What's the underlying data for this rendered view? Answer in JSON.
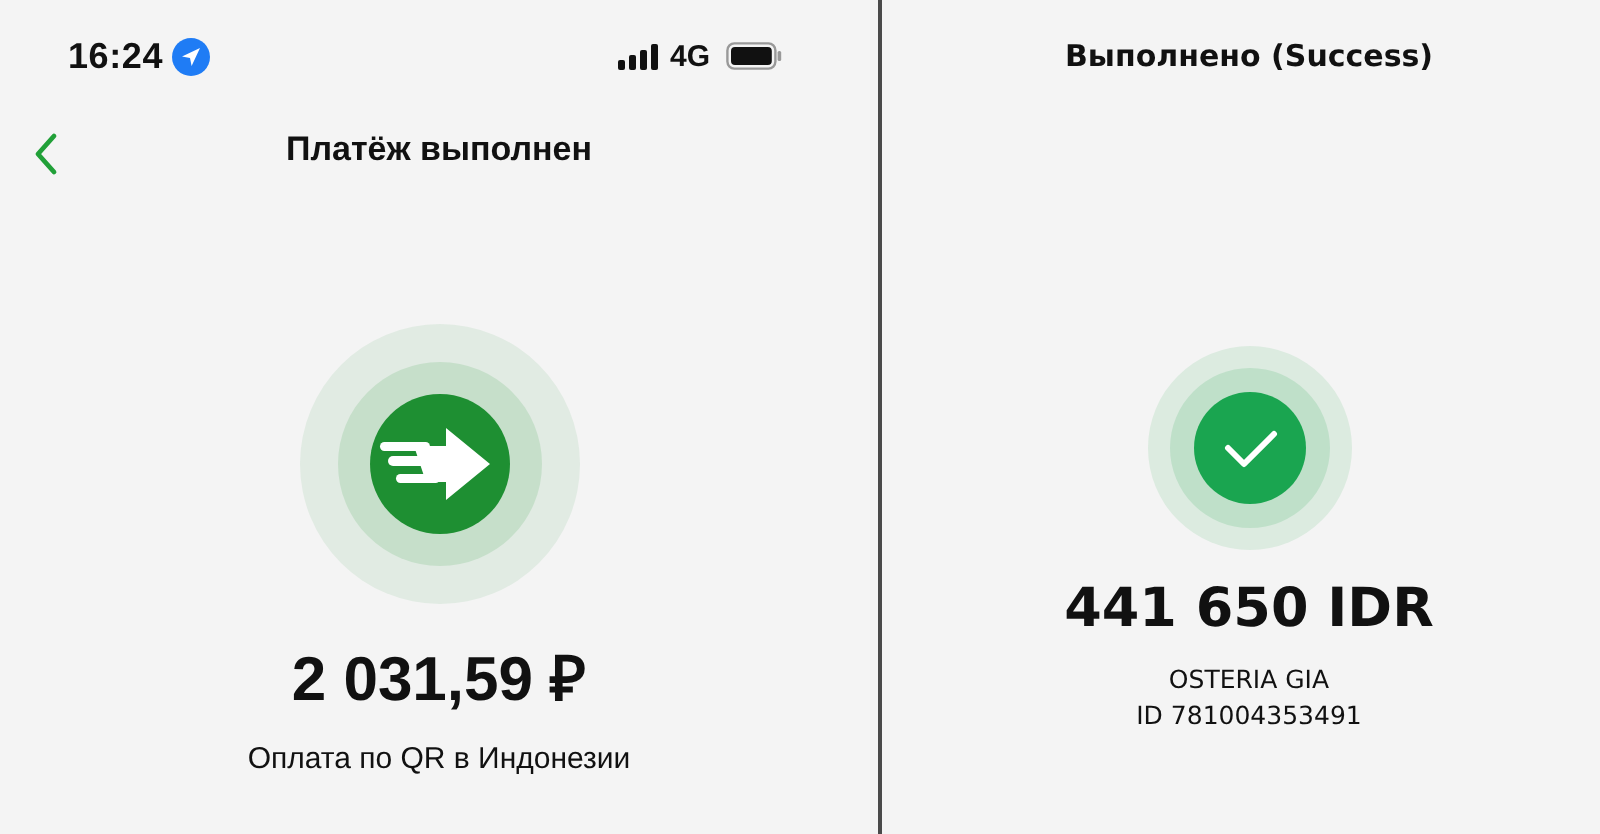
{
  "left": {
    "status_bar": {
      "time": "16:24",
      "network": "4G"
    },
    "header": {
      "title": "Платёж выполнен"
    },
    "amount": "2 031,59 ₽",
    "description": "Оплата по QR в Индонезии"
  },
  "right": {
    "title": "Выполнено (Success)",
    "amount": "441 650 IDR",
    "merchant": "OSTERIA GIA",
    "transaction_id": "ID 781004353491"
  }
}
